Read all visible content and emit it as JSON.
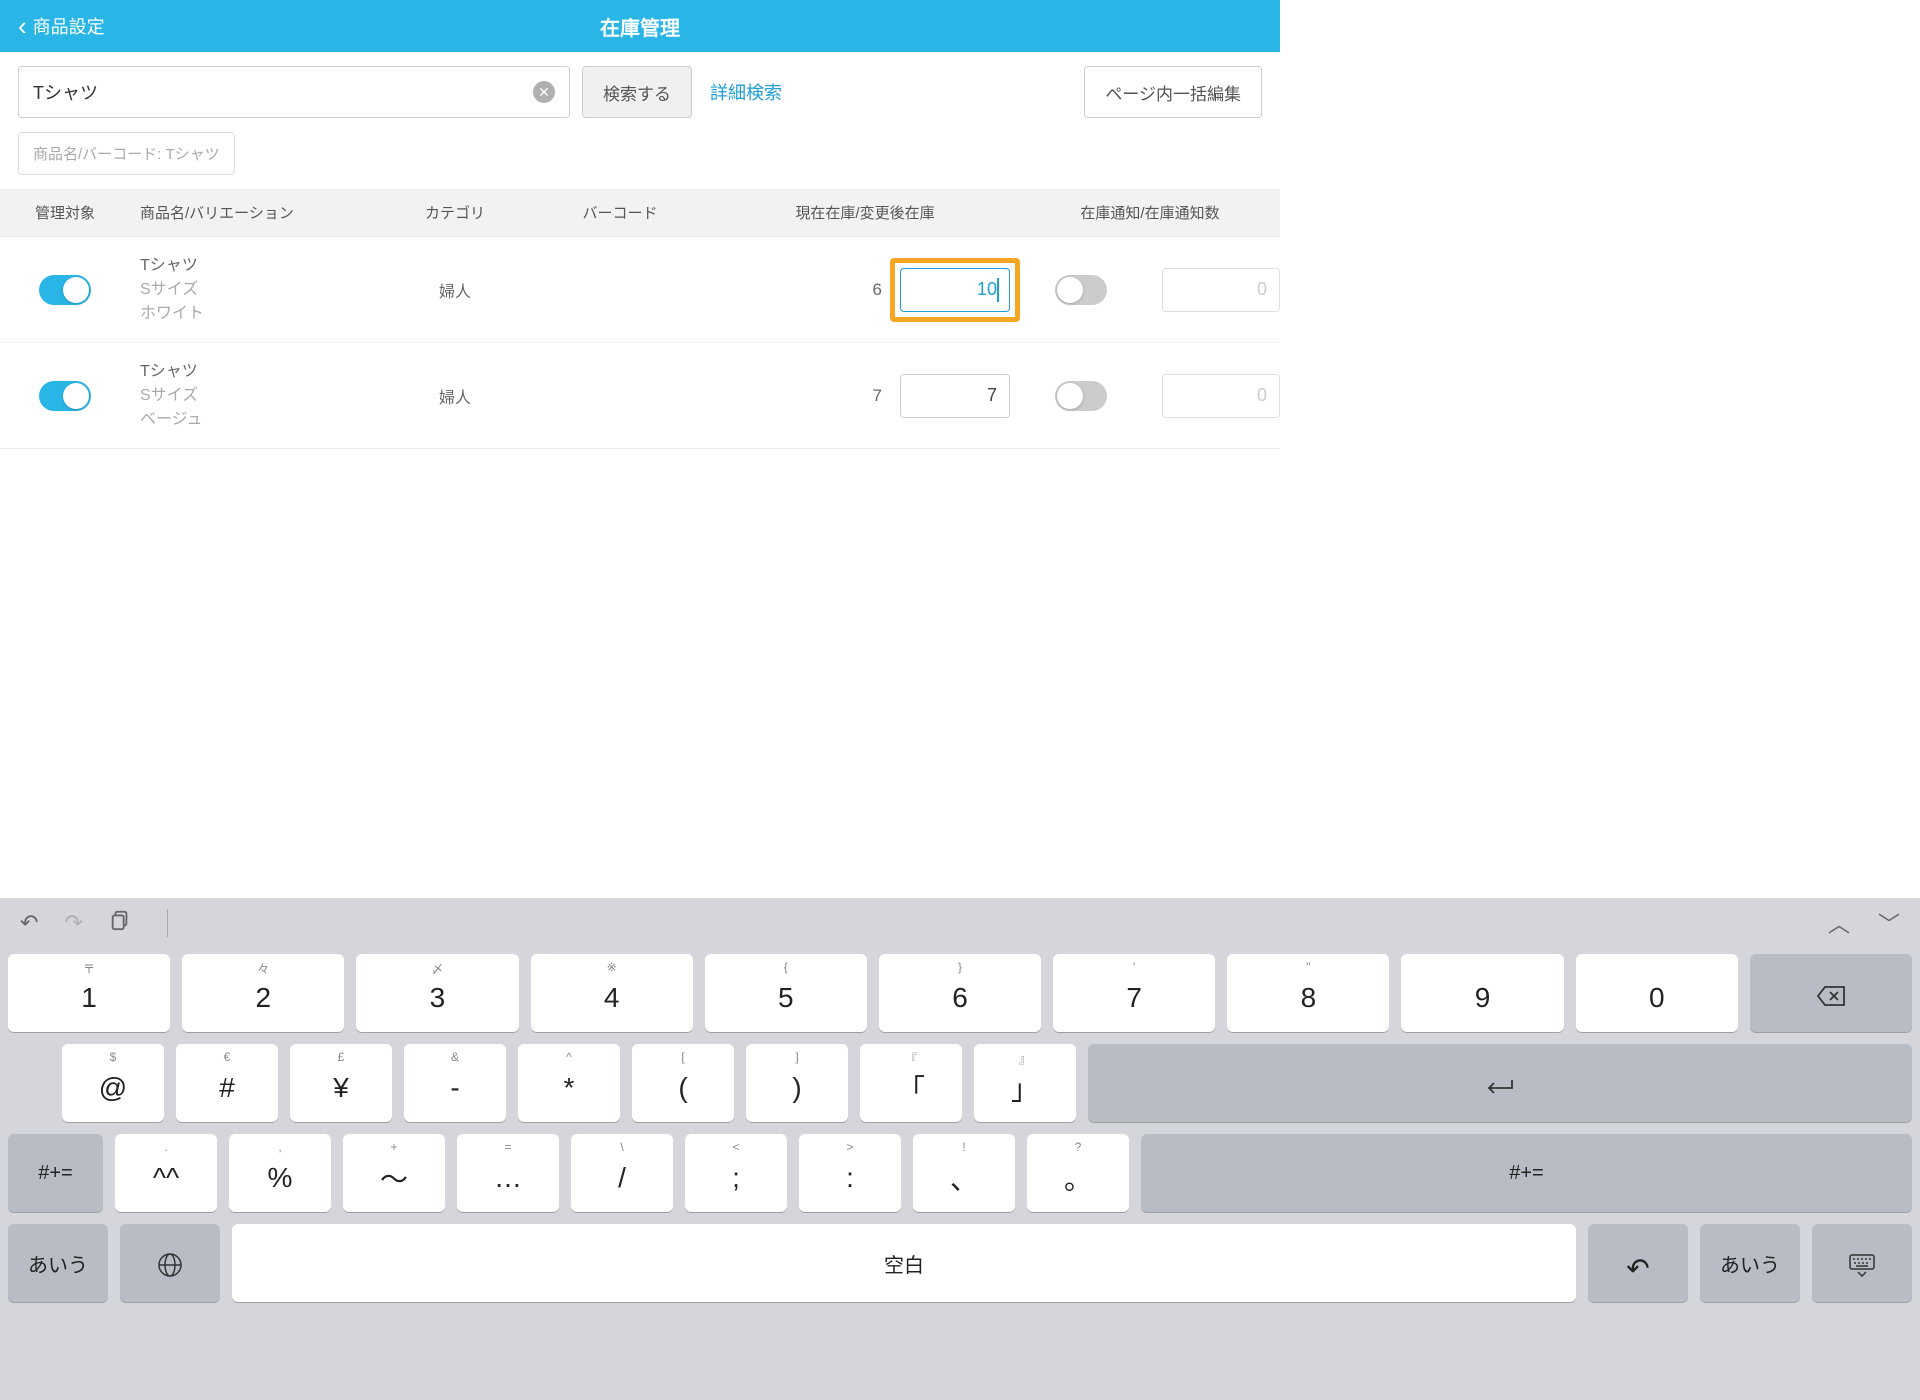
{
  "header": {
    "back": "商品設定",
    "title": "在庫管理"
  },
  "search": {
    "value": "Tシャツ",
    "button": "検索する",
    "advanced": "詳細検索",
    "batch": "ページ内一括編集"
  },
  "filter_chip": "商品名/バーコード: Tシャツ",
  "columns": {
    "manage": "管理対象",
    "name": "商品名/バリエーション",
    "category": "カテゴリ",
    "barcode": "バーコード",
    "stock": "現在在庫/変更後在庫",
    "notify": "在庫通知/在庫通知数"
  },
  "rows": [
    {
      "name": "Tシャツ",
      "size": "Sサイズ",
      "color": "ホワイト",
      "category": "婦人",
      "current": "6",
      "after": "10",
      "notify_val": "0",
      "active": true
    },
    {
      "name": "Tシャツ",
      "size": "Sサイズ",
      "color": "ベージュ",
      "category": "婦人",
      "current": "7",
      "after": "7",
      "notify_val": "0",
      "active": false
    }
  ],
  "keyboard": {
    "row1": [
      {
        "s": "〒",
        "m": "1"
      },
      {
        "s": "々",
        "m": "2"
      },
      {
        "s": "〆",
        "m": "3"
      },
      {
        "s": "※",
        "m": "4"
      },
      {
        "s": "{",
        "m": "5"
      },
      {
        "s": "}",
        "m": "6"
      },
      {
        "s": "'",
        "m": "7"
      },
      {
        "s": "\"",
        "m": "8"
      },
      {
        "s": "",
        "m": "9"
      },
      {
        "s": "",
        "m": "0"
      }
    ],
    "row2": [
      {
        "s": "$",
        "m": "@"
      },
      {
        "s": "€",
        "m": "#"
      },
      {
        "s": "£",
        "m": "¥"
      },
      {
        "s": "&",
        "m": "-"
      },
      {
        "s": "^",
        "m": "*"
      },
      {
        "s": "[",
        "m": "("
      },
      {
        "s": "]",
        "m": ")"
      },
      {
        "s": "『",
        "m": "「"
      },
      {
        "s": "』",
        "m": "」"
      }
    ],
    "row3": [
      {
        "s": ".",
        "m": "^^"
      },
      {
        "s": ",",
        "m": "%"
      },
      {
        "s": "+",
        "m": "〜"
      },
      {
        "s": "=",
        "m": "…"
      },
      {
        "s": "\\",
        "m": "/"
      },
      {
        "s": "<",
        "m": ";"
      },
      {
        "s": ">",
        "m": ":"
      },
      {
        "s": "!",
        "m": "、"
      },
      {
        "s": "?",
        "m": "。"
      }
    ],
    "shift": "#+=",
    "mode": "あいう",
    "space": "空白"
  }
}
